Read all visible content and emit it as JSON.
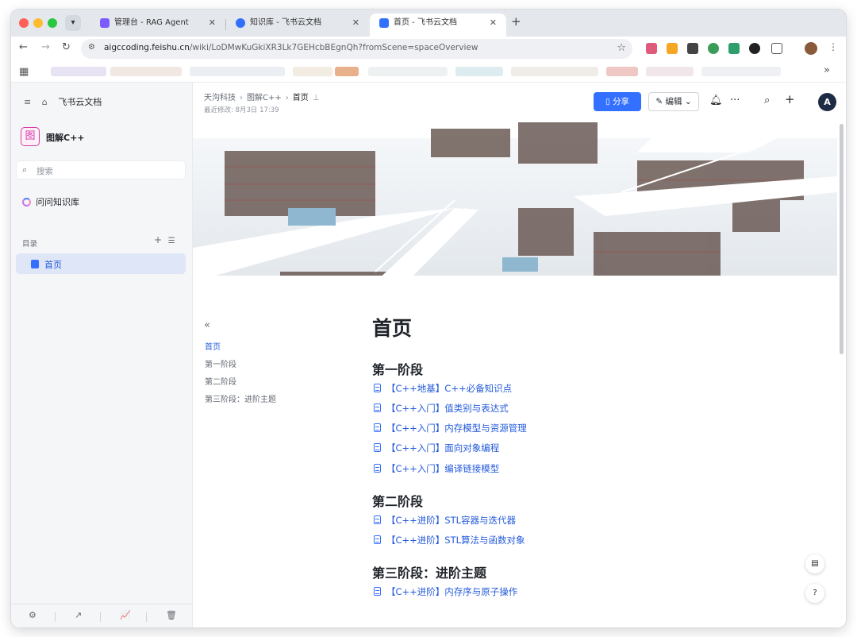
{
  "browser": {
    "tabs": [
      {
        "title": "管理台 - RAG Agent",
        "color": "#7b5cff"
      },
      {
        "title": "知识库 - 飞书云文档",
        "color": "#3370ff"
      },
      {
        "title": "首页 - 飞书云文档",
        "color": "#3370ff"
      }
    ],
    "url_host": "aigccoding.feishu.cn",
    "url_path": "/wiki/LoDMwKuGkiXR3Lk7GEHcbBEgnQh?fromScene=spaceOverview"
  },
  "sidebar": {
    "product_name": "飞书云文档",
    "space_icon_char": "图",
    "space_name": "图解C++",
    "search_placeholder": "搜索",
    "ask_label": "问问知识库",
    "toc_label": "目录",
    "toc_items": [
      {
        "label": "首页"
      }
    ]
  },
  "header": {
    "breadcrumb": [
      "天沟科技",
      "图解C++",
      "首页"
    ],
    "modified": "最近修改: 8月3日 17:39",
    "share_label": "分享",
    "edit_label": "编辑",
    "avatar_letter": "A"
  },
  "outline": [
    "首页",
    "第一阶段",
    "第二阶段",
    "第三阶段：进阶主题"
  ],
  "doc": {
    "title": "首页",
    "sections": [
      {
        "heading": "第一阶段",
        "links": [
          "【C++地基】C++必备知识点",
          "【C++入门】值类别与表达式",
          "【C++入门】内存模型与资源管理",
          "【C++入门】面向对象编程",
          "【C++入门】编译链接模型"
        ]
      },
      {
        "heading": "第二阶段",
        "links": [
          "【C++进阶】STL容器与迭代器",
          "【C++进阶】STL算法与函数对象"
        ]
      },
      {
        "heading": "第三阶段：进阶主题",
        "links": [
          "【C++进阶】内存序与原子操作"
        ]
      }
    ]
  }
}
